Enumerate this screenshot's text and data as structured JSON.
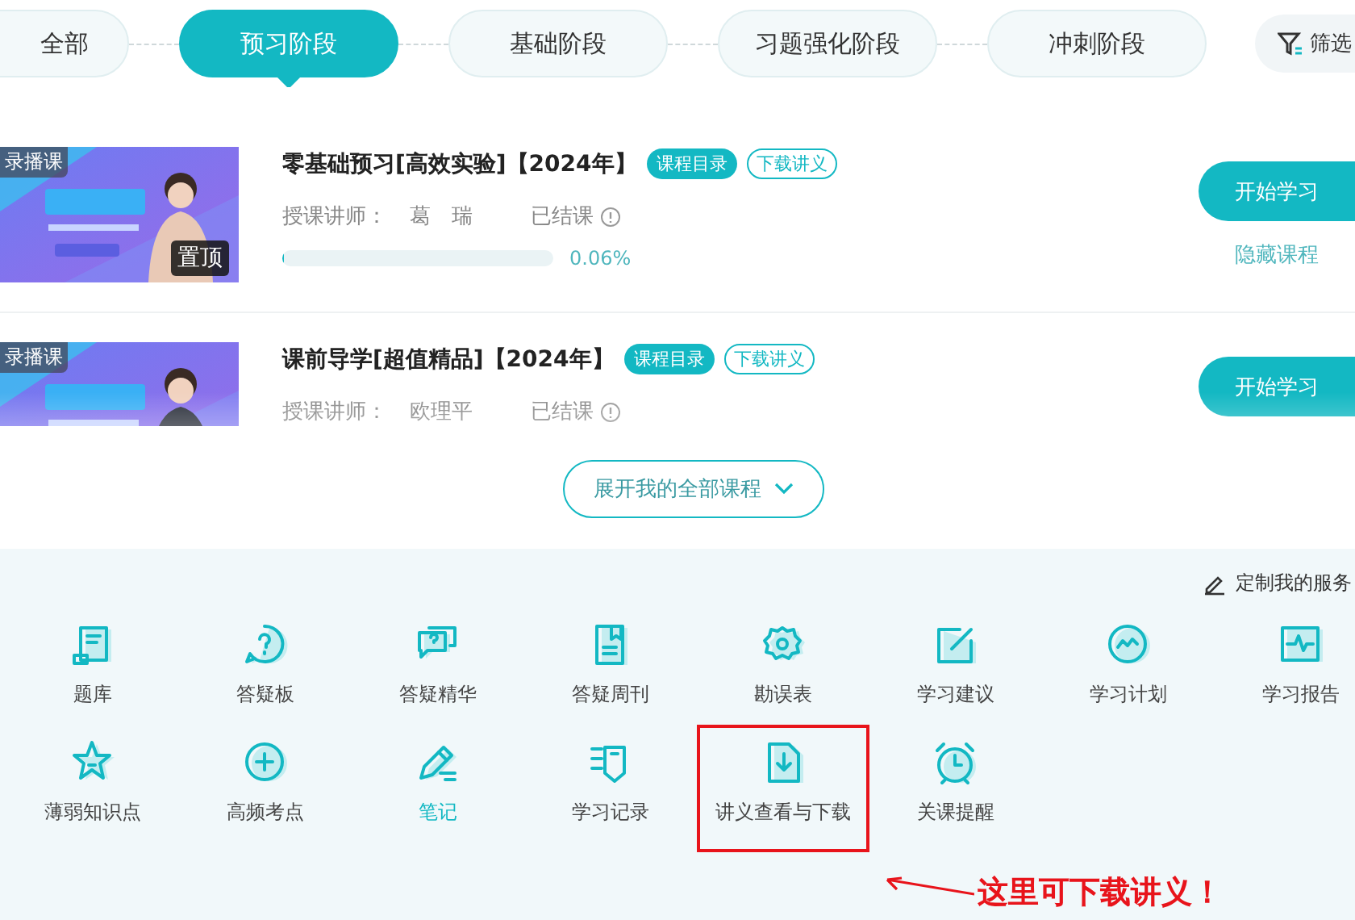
{
  "stage_tabs": [
    {
      "label": "全部",
      "selected": false
    },
    {
      "label": "预习阶段",
      "selected": true
    },
    {
      "label": "基础阶段",
      "selected": false
    },
    {
      "label": "习题强化阶段",
      "selected": false
    },
    {
      "label": "冲刺阶段",
      "selected": false
    }
  ],
  "filter_button": {
    "label": "筛选"
  },
  "courses": [
    {
      "badge": "录播课",
      "pinned_label": "置顶",
      "title": "零基础预习[高效实验]【2024年】",
      "catalog_button": "课程目录",
      "handout_button": "下载讲义",
      "teacher_label": "授课讲师：",
      "teacher": "葛　瑞",
      "status": "已结课",
      "progress": {
        "level": 0.0006,
        "reading": "0.06%"
      },
      "start_button": "开始学习",
      "hide_link": "隐藏课程",
      "faded": false
    },
    {
      "badge": "录播课",
      "title": "课前导学[超值精品]【2024年】",
      "catalog_button": "课程目录",
      "handout_button": "下载讲义",
      "teacher_label": "授课讲师：",
      "teacher": "欧理平",
      "status": "已结课",
      "start_button": "开始学习",
      "faded": true
    }
  ],
  "expand_button": {
    "label": "展开我的全部课程"
  },
  "service_panel": {
    "customize_link": "定制我的服务",
    "tools": [
      {
        "label": "题库",
        "highlighted": false,
        "boxed": false
      },
      {
        "label": "答疑板",
        "highlighted": false,
        "boxed": false
      },
      {
        "label": "答疑精华",
        "highlighted": false,
        "boxed": false
      },
      {
        "label": "答疑周刊",
        "highlighted": false,
        "boxed": false
      },
      {
        "label": "勘误表",
        "highlighted": false,
        "boxed": false
      },
      {
        "label": "学习建议",
        "highlighted": false,
        "boxed": false
      },
      {
        "label": "学习计划",
        "highlighted": false,
        "boxed": false
      },
      {
        "label": "学习报告",
        "highlighted": false,
        "boxed": false
      },
      {
        "label": "薄弱知识点",
        "highlighted": false,
        "boxed": false
      },
      {
        "label": "高频考点",
        "highlighted": false,
        "boxed": false
      },
      {
        "label": "笔记",
        "highlighted": true,
        "boxed": false
      },
      {
        "label": "学习记录",
        "highlighted": false,
        "boxed": false
      },
      {
        "label": "讲义查看与下载",
        "highlighted": false,
        "boxed": true
      },
      {
        "label": "关课提醒",
        "highlighted": false,
        "boxed": false
      }
    ],
    "callout": {
      "text": "这里可下载讲义！"
    }
  }
}
